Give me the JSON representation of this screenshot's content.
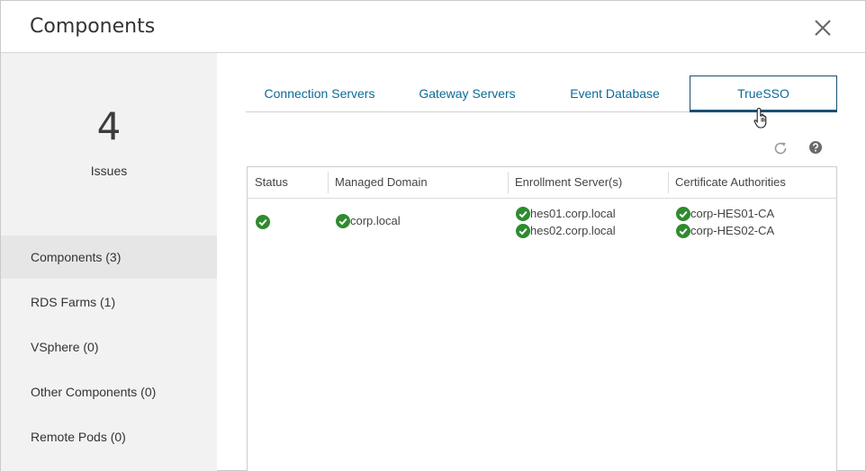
{
  "header": {
    "title": "Components"
  },
  "sidebar": {
    "issue_count": "4",
    "issue_label": "Issues",
    "items": [
      {
        "label": "Components (3)"
      },
      {
        "label": "RDS Farms (1)"
      },
      {
        "label": "VSphere (0)"
      },
      {
        "label": "Other Components (0)"
      },
      {
        "label": "Remote Pods (0)"
      }
    ]
  },
  "tabs": [
    {
      "label": "Connection Servers"
    },
    {
      "label": "Gateway Servers"
    },
    {
      "label": "Event Database"
    },
    {
      "label": "TrueSSO"
    }
  ],
  "table": {
    "columns": [
      "Status",
      "Managed Domain",
      "Enrollment Server(s)",
      "Certificate Authorities"
    ],
    "rows": [
      {
        "managed_domain": "corp.local",
        "enrollment_servers": [
          "hes01.corp.local",
          "hes02.corp.local"
        ],
        "certificate_authorities": [
          "corp-HES01-CA",
          "corp-HES02-CA"
        ]
      }
    ]
  },
  "colors": {
    "accent": "#0a6b96",
    "active_tab_border": "#1a4f74",
    "ok_green": "#2e8b2e"
  }
}
